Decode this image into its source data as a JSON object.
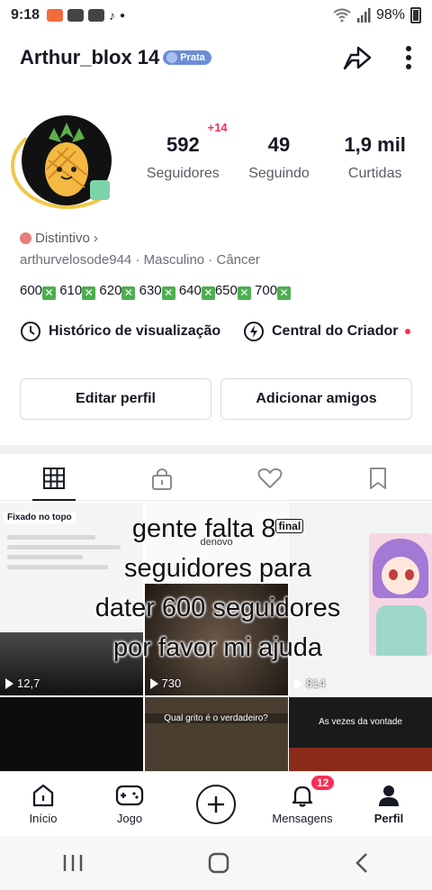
{
  "status_bar": {
    "time": "9:18",
    "battery": "98%"
  },
  "header": {
    "username": "Arthur_blox 14",
    "level_badge": "Prata"
  },
  "stats": [
    {
      "value": "592",
      "label": "Seguidores",
      "delta": "+14"
    },
    {
      "value": "49",
      "label": "Seguindo",
      "delta": ""
    },
    {
      "value": "1,9 mil",
      "label": "Curtidas",
      "delta": ""
    }
  ],
  "profile": {
    "badge_link": "Distintivo",
    "handle": "arthurvelosode944",
    "gender": "Masculino",
    "sign": "Câncer",
    "bio_numbers": [
      "600",
      "610",
      "620",
      "630",
      "640",
      "650",
      "700"
    ]
  },
  "quick_links": {
    "history": "Histórico de visualização",
    "creator": "Central do Criador"
  },
  "buttons": {
    "edit": "Editar perfil",
    "add_friends": "Adicionar amigos"
  },
  "grid": {
    "pinned_label": "Fixado no topo",
    "views": [
      "12,7",
      "730",
      "814"
    ],
    "captions": [
      "Qual grito é o verdadeiro?",
      "As vezes da vontade"
    ],
    "partial_text": "denovo"
  },
  "overlay_text": [
    "gente falta 8",
    "seguidores para",
    "dater 600 seguidores",
    "por favor mi ajuda"
  ],
  "overlay_sticker": "final",
  "bottom_nav": {
    "home": "Início",
    "game": "Jogo",
    "messages": "Mensagens",
    "messages_badge": "12",
    "profile": "Perfil"
  },
  "colors": {
    "accent_red": "#fe2c55",
    "badge_blue": "#6b8ed6",
    "check_green": "#4caf50"
  }
}
